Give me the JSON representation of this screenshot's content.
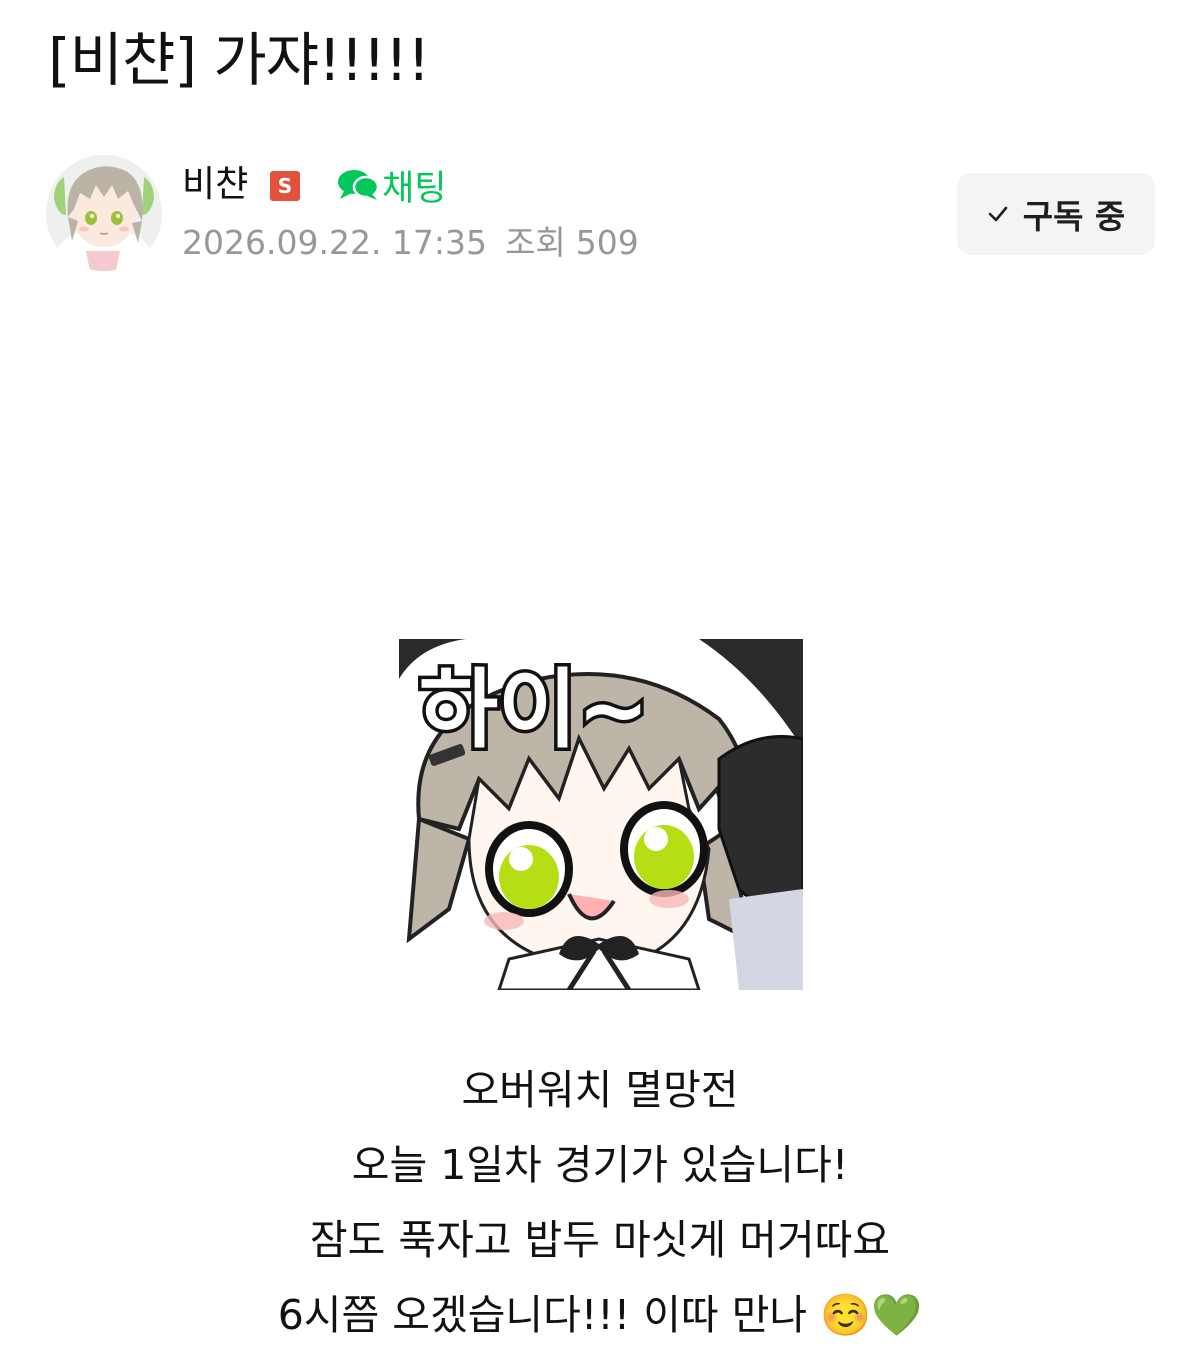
{
  "post": {
    "title": "[비챤] 가쟈!!!!!"
  },
  "author": {
    "name": "비챤",
    "badge": "S",
    "badge_color": "#e0523e",
    "avatar_icon": "anime-character-avatar"
  },
  "chat": {
    "icon": "chat-bubbles-icon",
    "label": "채팅",
    "color": "#03c75a"
  },
  "meta": {
    "date": "2026.09.22. 17:35",
    "views_label": "조회",
    "views_count": "509"
  },
  "subscribe": {
    "icon": "check-icon",
    "label": "구독 중"
  },
  "sticker": {
    "text": "하이~",
    "description_icon": "waving-character-sticker"
  },
  "body": {
    "lines": [
      "오버워치 멸망전",
      "오늘 1일차 경기가 있습니다!",
      "잠도 푹자고 밥두 마싯게 머거따요",
      "6시쯤 오겠습니다!!! 이따 만나 ☺️💚"
    ]
  }
}
